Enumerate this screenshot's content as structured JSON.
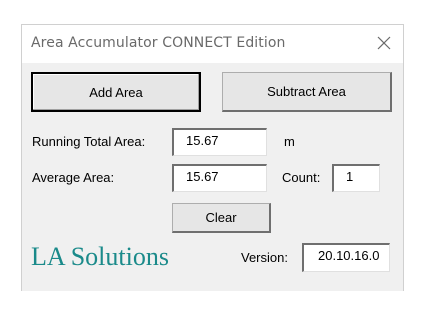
{
  "window": {
    "title": "Area Accumulator CONNECT Edition",
    "close_glyph": "✕"
  },
  "buttons": {
    "add_area": "Add Area",
    "subtract_area": "Subtract Area",
    "clear": "Clear"
  },
  "fields": {
    "running_total_label": "Running Total Area:",
    "running_total_value": "15.67",
    "running_total_unit": "m",
    "average_label": "Average Area:",
    "average_value": "15.67",
    "count_label": "Count:",
    "count_value": "1",
    "version_label": "Version:",
    "version_value": "20.10.16.0"
  },
  "brand": {
    "name": "LA Solutions",
    "color": "#1a8a8a"
  }
}
